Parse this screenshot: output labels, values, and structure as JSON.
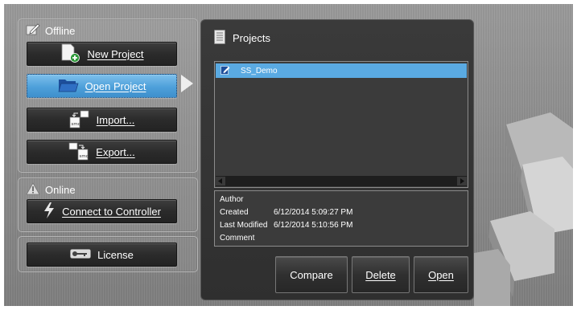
{
  "offline": {
    "title": "Offline",
    "new_project_label": "New Project",
    "open_project_label": "Open Project",
    "import_label": "Import...",
    "export_label": "Export..."
  },
  "online": {
    "title": "Online",
    "connect_label": "Connect to Controller"
  },
  "license": {
    "label": "License"
  },
  "projects": {
    "title": "Projects",
    "items": [
      {
        "name": "SS_Demo",
        "selected": true
      }
    ],
    "details": {
      "author_label": "Author",
      "author_value": "",
      "created_label": "Created",
      "created_value": "6/12/2014 5:09:27 PM",
      "modified_label": "Last Modified",
      "modified_value": "6/12/2014 5:10:56 PM",
      "comment_label": "Comment",
      "comment_value": ""
    },
    "buttons": {
      "compare": "Compare",
      "delete": "Delete",
      "open": "Open"
    }
  },
  "colors": {
    "selected": "#5aaae2",
    "button_dark": "#2b2b2b",
    "panel": "#333333"
  },
  "icons": [
    "edit-icon",
    "new-project-icon",
    "folder-icon",
    "import-icon",
    "export-icon",
    "warning-icon",
    "lightning-icon",
    "key-icon",
    "projects-list-icon",
    "project-file-icon"
  ]
}
